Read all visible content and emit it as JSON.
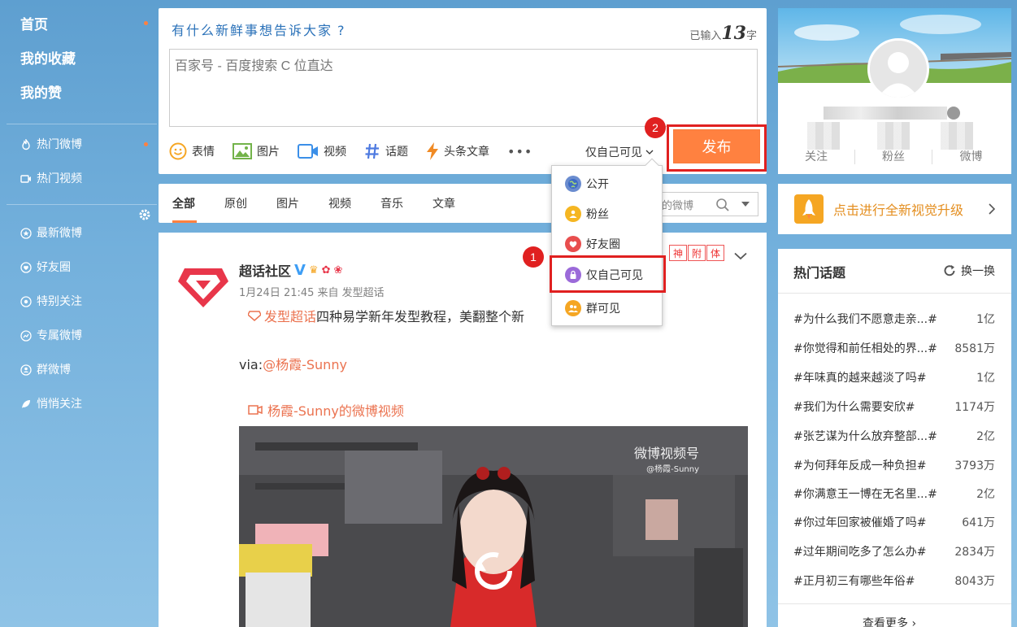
{
  "nav": {
    "top": [
      {
        "label": "首页",
        "dot": true
      },
      {
        "label": "我的收藏",
        "dot": false
      },
      {
        "label": "我的赞",
        "dot": false
      }
    ],
    "hot": [
      {
        "label": "热门微博",
        "icon": "flame-icon",
        "dot": true
      },
      {
        "label": "热门视频",
        "icon": "video-icon",
        "dot": false
      }
    ],
    "groups": [
      {
        "label": "最新微博",
        "icon": "star-icon"
      },
      {
        "label": "好友圈",
        "icon": "heart-icon"
      },
      {
        "label": "特别关注",
        "icon": "eye-icon"
      },
      {
        "label": "专属微博",
        "icon": "chart-icon"
      },
      {
        "label": "群微博",
        "icon": "group-icon"
      },
      {
        "label": "悄悄关注",
        "icon": "leaf-icon"
      }
    ]
  },
  "compose": {
    "prompt": "有什么新鲜事想告诉大家",
    "count_prefix": "已输入",
    "count": "13",
    "count_suffix": "字",
    "text": "百家号 - 百度搜索 C 位直达",
    "tools": [
      "表情",
      "图片",
      "视频",
      "话题",
      "头条文章"
    ],
    "more": "•••",
    "visibility": "仅自己可见",
    "publish": "发布",
    "step_publish": "2",
    "step_option": "1"
  },
  "visibility_menu": {
    "options": [
      "公开",
      "粉丝",
      "好友圈",
      "仅自己可见",
      "群可见"
    ],
    "selected_index": 3
  },
  "tabs": {
    "items": [
      "全部",
      "原创",
      "图片",
      "视频",
      "音乐",
      "文章"
    ],
    "active_index": 0,
    "search_placeholder": "的微博"
  },
  "post": {
    "username": "超话社区",
    "verified": "V",
    "time": "1月24日 21:45 来自 发型超话",
    "topic_tag": "发型超话",
    "text": "四种易学新年发型教程，美翻整个新",
    "via_prefix": "via:",
    "via_user": "@杨霞-Sunny",
    "video_link": "杨霞-Sunny的微博视频",
    "watermark": "微博视频号",
    "watermark_user": "@杨霞-Sunny",
    "stamp": [
      "神",
      "附",
      "体"
    ]
  },
  "profile": {
    "stats": [
      "关注",
      "粉丝",
      "微博"
    ]
  },
  "upgrade": {
    "label": "点击进行全新视觉升级"
  },
  "hot_topics": {
    "title": "热门话题",
    "refresh": "换一换",
    "items": [
      {
        "topic": "#为什么我们不愿意走亲...#",
        "count": "1亿"
      },
      {
        "topic": "#你觉得和前任相处的界...#",
        "count": "8581万"
      },
      {
        "topic": "#年味真的越来越淡了吗#",
        "count": "1亿"
      },
      {
        "topic": "#我们为什么需要安欣#",
        "count": "1174万"
      },
      {
        "topic": "#张艺谋为什么放弃整部...#",
        "count": "2亿"
      },
      {
        "topic": "#为何拜年反成一种负担#",
        "count": "3793万"
      },
      {
        "topic": "#你满意王一博在无名里...#",
        "count": "2亿"
      },
      {
        "topic": "#你过年回家被催婚了吗#",
        "count": "641万"
      },
      {
        "topic": "#过年期间吃多了怎么办#",
        "count": "2834万"
      },
      {
        "topic": "#正月初三有哪些年俗#",
        "count": "8043万"
      }
    ],
    "more": "查看更多"
  },
  "colors": {
    "accent": "#ff8140",
    "highlight": "#e02020",
    "link": "#eb7350",
    "prompt": "#2b72b9"
  }
}
